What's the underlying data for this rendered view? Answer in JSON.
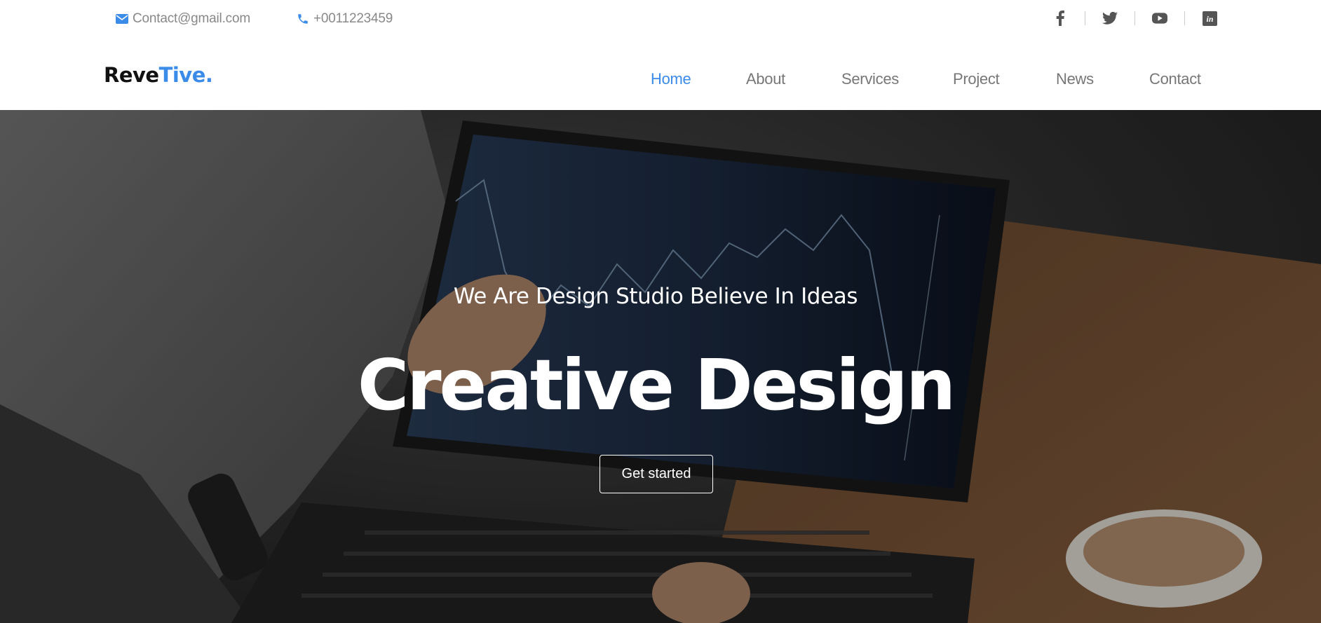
{
  "topbar": {
    "email": "Contact@gmail.com",
    "phone": "+0011223459",
    "socials": [
      "facebook-icon",
      "twitter-icon",
      "youtube-icon",
      "linkedin-icon"
    ]
  },
  "brand": {
    "logo_main": "Reve",
    "logo_accent": "Tive."
  },
  "nav": {
    "items": [
      "Home",
      "About",
      "Services",
      "Project",
      "News",
      "Contact"
    ],
    "active": "Home"
  },
  "hero": {
    "subtitle": "We Are Design Studio Believe In Ideas",
    "title": "Creative Design",
    "cta_label": "Get started"
  },
  "colors": {
    "accent": "#3b8be8",
    "muted_text": "#777777",
    "hero_text": "#ffffff"
  }
}
